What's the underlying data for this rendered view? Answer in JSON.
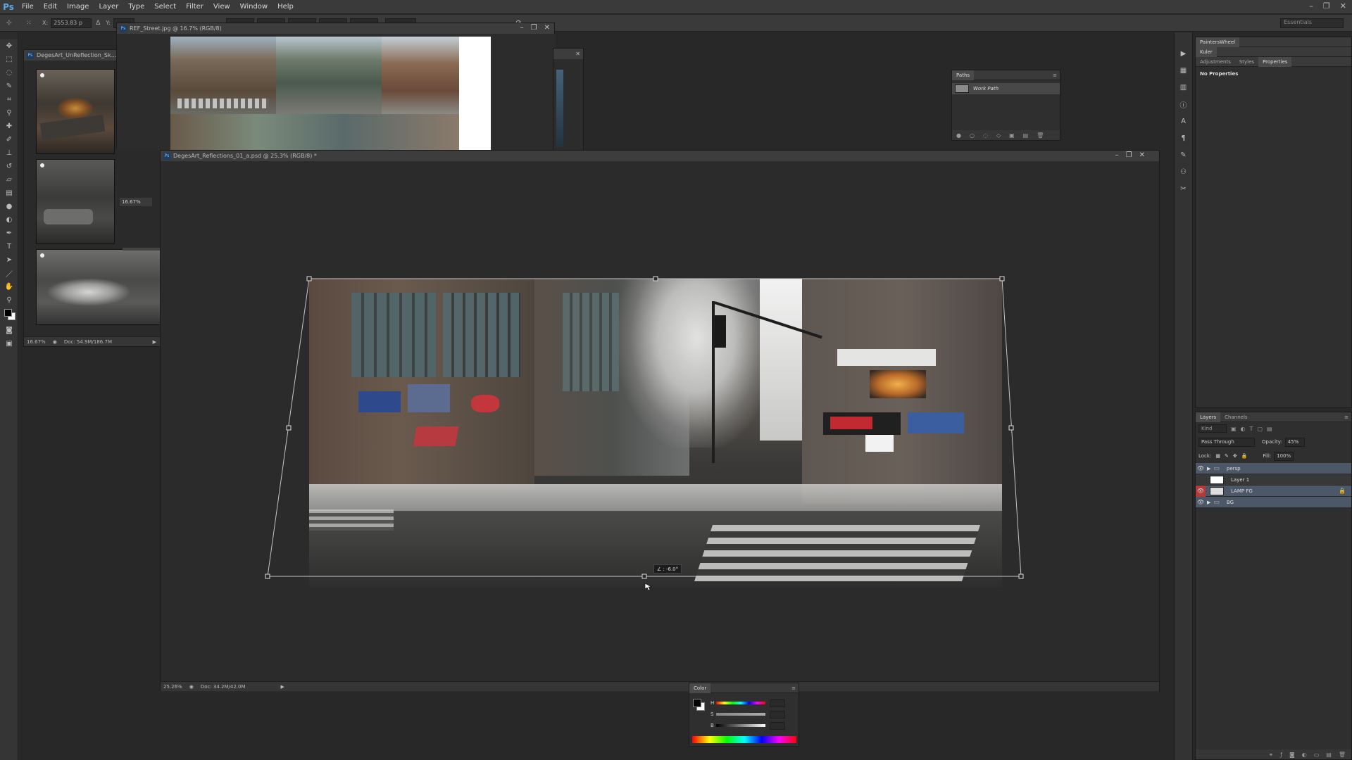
{
  "menu": {
    "logo": "Ps",
    "items": [
      "File",
      "Edit",
      "Image",
      "Layer",
      "Type",
      "Select",
      "Filter",
      "View",
      "Window",
      "Help"
    ]
  },
  "options": {
    "x_value": "2553.83 p",
    "workspace": "Essentials"
  },
  "doc_ref": {
    "title": "REF_Street.jpg @ 16.7% (RGB/8)"
  },
  "doc_unhandled": {
    "title": "DegesArt_UnReflection_Sk…",
    "zoom": "16.67%",
    "zoom2": "16.67%",
    "doc_size": "Doc: 54.9M/186.7M"
  },
  "doc_main": {
    "title": "DegesArt_Reflections_01_a.psd @ 25.3% (RGB/8) *",
    "zoom": "25.26%",
    "doc_size": "Doc: 34.2M/42.0M",
    "angle_readout": "∠ : -6.0°"
  },
  "paths_panel": {
    "tab": "Paths",
    "item": "Work Path"
  },
  "right_panel": {
    "tabs_top": [
      "PaintersWheel",
      "Kuler"
    ],
    "tabs_props": [
      "Adjustments",
      "Styles",
      "Properties"
    ],
    "no_props": "No Properties"
  },
  "layers_panel": {
    "tabs": [
      "Layers",
      "Channels"
    ],
    "kind": "Kind",
    "blend_mode": "Pass Through",
    "opacity_label": "Opacity:",
    "opacity_value": "45%",
    "lock_label": "Lock:",
    "fill_label": "Fill:",
    "fill_value": "100%",
    "layers": [
      {
        "name": "persp",
        "type": "group"
      },
      {
        "name": "Layer 1",
        "type": "layer"
      },
      {
        "name": "LAMP FG",
        "type": "layer"
      },
      {
        "name": "BG",
        "type": "group"
      }
    ]
  },
  "color_panel": {
    "tab": "Color",
    "channels": [
      "H",
      "S",
      "B"
    ]
  },
  "colors": {
    "accent": "#5aa6e6",
    "selected_layer": "#4c5868"
  },
  "icons": {
    "tools": [
      "move-icon",
      "marquee-icon",
      "lasso-icon",
      "quick-select-icon",
      "crop-icon",
      "eyedropper-icon",
      "healing-icon",
      "brush-icon",
      "stamp-icon",
      "history-brush-icon",
      "eraser-icon",
      "gradient-icon",
      "blur-icon",
      "dodge-icon",
      "pen-icon",
      "type-icon",
      "path-select-icon",
      "shape-icon",
      "hand-icon",
      "zoom-icon"
    ]
  }
}
